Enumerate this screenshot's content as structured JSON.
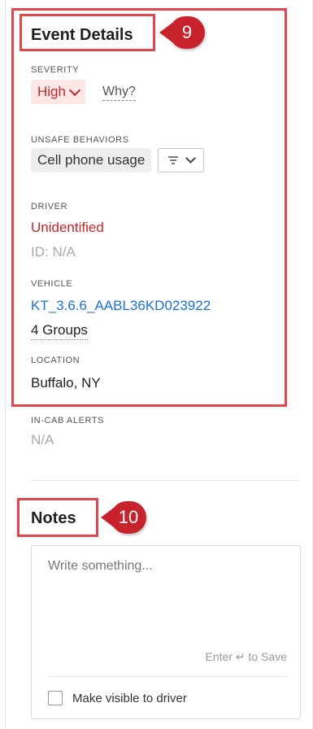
{
  "event_details": {
    "title": "Event Details",
    "severity": {
      "label": "SEVERITY",
      "value": "High",
      "why_link": "Why?"
    },
    "unsafe_behaviors": {
      "label": "UNSAFE BEHAVIORS",
      "chip": "Cell phone usage"
    },
    "driver": {
      "label": "DRIVER",
      "name": "Unidentified",
      "id": "ID: N/A"
    },
    "vehicle": {
      "label": "VEHICLE",
      "name": "KT_3.6.6_AABL36KD023922",
      "groups": "4 Groups"
    },
    "location": {
      "label": "LOCATION",
      "value": "Buffalo, NY"
    },
    "in_cab_alerts": {
      "label": "IN-CAB ALERTS",
      "value": "N/A"
    }
  },
  "notes": {
    "title": "Notes",
    "placeholder": "Write something...",
    "save_hint": "Enter ↵ to Save",
    "visibility_label": "Make visible to driver"
  },
  "callouts": {
    "event_details": "9",
    "notes": "10"
  },
  "colors": {
    "annotation_red": "#e0474f",
    "badge_red": "#c8232c",
    "severity_text": "#c62828",
    "severity_bg": "#fde6e6",
    "link_blue": "#1f6fd1"
  },
  "icons": {
    "severity_dropdown": "chevron-down-icon",
    "behavior_filter": "filter-lines-icon"
  }
}
